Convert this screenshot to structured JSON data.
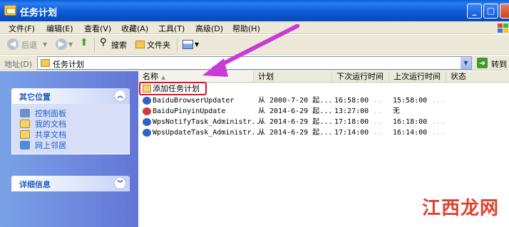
{
  "window": {
    "title": "任务计划"
  },
  "menu": [
    "文件(F)",
    "编辑(E)",
    "查看(V)",
    "收藏(A)",
    "工具(T)",
    "高级(D)",
    "帮助(H)"
  ],
  "toolbar": {
    "back": "后退",
    "search": "搜索",
    "folders": "文件夹"
  },
  "address": {
    "label": "地址(D)",
    "value": "任务计划",
    "go": "转到"
  },
  "sidebar": {
    "other_places": {
      "title": "其它位置",
      "items": [
        "控制面板",
        "我的文档",
        "共享文档",
        "网上邻居"
      ]
    },
    "details": {
      "title": "详细信息"
    }
  },
  "columns": [
    "名称",
    "计划",
    "下次运行时间",
    "上次运行时间",
    "状态"
  ],
  "add_task": "添加任务计划",
  "tasks": [
    {
      "name": "BaiduBrowserUpdater",
      "schedule": "从 2000-7-20 起...",
      "next": "16:58:00",
      "last": "15:58:00",
      "dots1": "..",
      "dots2": "..."
    },
    {
      "name": "BaiduPinyinUpdate",
      "schedule": "从 2014-6-29 起...",
      "next": "13:27:00",
      "last": "无",
      "dots1": "..",
      "dots2": ""
    },
    {
      "name": "WpsNotifyTask_Administr...",
      "schedule": "从 2014-6-29 起...",
      "next": "17:18:00",
      "last": "16:18:00",
      "dots1": "..",
      "dots2": "..."
    },
    {
      "name": "WpsUpdateTask_Administr...",
      "schedule": "从 2014-6-29 起...",
      "next": "17:14:00",
      "last": "16:14:00",
      "dots1": "..",
      "dots2": "..."
    }
  ],
  "watermark": {
    "text": "江西龙网"
  },
  "colors": {
    "titlebar": "#0a5fd8",
    "sidebar": "#6375d6",
    "highlight": "#e0102a",
    "arrow": "#c93ad6"
  }
}
